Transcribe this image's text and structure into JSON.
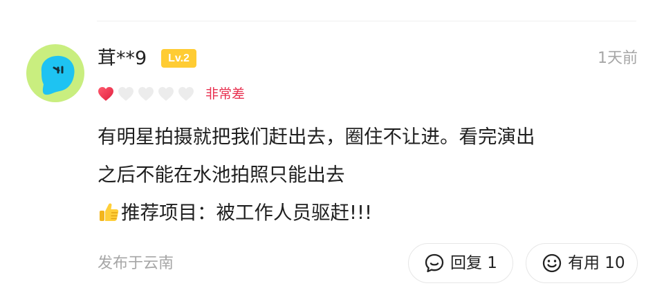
{
  "comment": {
    "username": "茸**9",
    "level_badge": "Lv.2",
    "time": "1天前",
    "rating": {
      "value": 1,
      "max": 5,
      "label": "非常差"
    },
    "content_lines": [
      "有明星拍摄就把我们赶出去，圈住不让进。看完演出",
      "之后不能在水池拍照只能出去"
    ],
    "recommend_text": "推荐项目：被工作人员驱赶!!!",
    "location": "发布于云南",
    "actions": {
      "reply_label": "回复 1",
      "useful_label": "有用 10"
    }
  },
  "icons": {
    "avatar": "blue-blob-avatar",
    "heart_filled": "heart-filled-icon",
    "heart_empty": "heart-empty-icon",
    "thumb": "thumbs-up-icon",
    "reply": "comment-bubble-icon",
    "useful": "smiley-icon"
  },
  "colors": {
    "rating_red": "#e8304f",
    "badge_yellow": "#ffcc33",
    "avatar_green": "#c9ee7f",
    "avatar_blue": "#1ec3f2",
    "muted_gray": "#a6a6a6"
  }
}
